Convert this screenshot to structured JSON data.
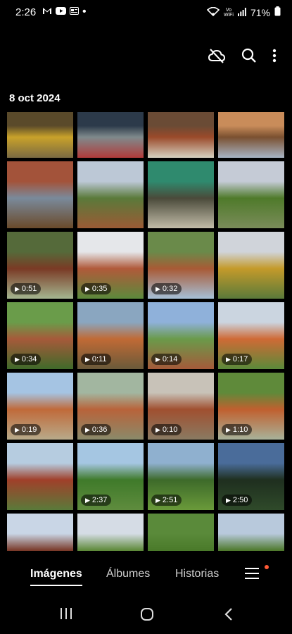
{
  "status_bar": {
    "time": "2:26",
    "battery": "71%",
    "wifi_label_1": "Vo",
    "wifi_label_2": "WiFi"
  },
  "gallery": {
    "date_header": "8 oct 2024",
    "tiles": [
      {
        "colors": [
          "#5a4a2a",
          "#c9a22a",
          "#7a6a42"
        ],
        "duration": ""
      },
      {
        "colors": [
          "#2c3a4a",
          "#7f8a8c",
          "#b23a3a"
        ],
        "duration": ""
      },
      {
        "colors": [
          "#6a4b35",
          "#9b4a2a",
          "#d5d0c0"
        ],
        "duration": ""
      },
      {
        "colors": [
          "#c98c5a",
          "#7a5030",
          "#a7b4c4"
        ],
        "duration": ""
      },
      {
        "colors": [
          "#a3533a",
          "#7a8a9b",
          "#6a4a2a"
        ],
        "duration": ""
      },
      {
        "colors": [
          "#bcc8d6",
          "#5a7a3a",
          "#9b5a35"
        ],
        "duration": ""
      },
      {
        "colors": [
          "#2f8a6e",
          "#4a4a3a",
          "#c2bca8"
        ],
        "duration": ""
      },
      {
        "colors": [
          "#c5cbd6",
          "#4f7a2a",
          "#7a8c5a"
        ],
        "duration": ""
      },
      {
        "colors": [
          "#556a3a",
          "#7a3a25",
          "#a4b690"
        ],
        "duration": "0:51"
      },
      {
        "colors": [
          "#e5e7ea",
          "#b05a3a",
          "#5c8a3c"
        ],
        "duration": "0:35"
      },
      {
        "colors": [
          "#6a8a4a",
          "#a85a35",
          "#a6c0d8"
        ],
        "duration": "0:32"
      },
      {
        "colors": [
          "#d0d4da",
          "#c49a2a",
          "#5a7a3a"
        ],
        "duration": ""
      },
      {
        "colors": [
          "#6a9c4a",
          "#a65a3a",
          "#3f6a2a"
        ],
        "duration": "0:34"
      },
      {
        "colors": [
          "#8aa6c0",
          "#c06a35",
          "#6a5a3a"
        ],
        "duration": "0:11"
      },
      {
        "colors": [
          "#8fb1da",
          "#6a9a4a",
          "#a55a3a"
        ],
        "duration": "0:14"
      },
      {
        "colors": [
          "#cbd5e0",
          "#cf6a35",
          "#5a8a3a"
        ],
        "duration": "0:17"
      },
      {
        "colors": [
          "#a5c4e3",
          "#c06a3a",
          "#b8aa8a"
        ],
        "duration": "0:19"
      },
      {
        "colors": [
          "#a2b6a0",
          "#b8633a",
          "#8a8a6a"
        ],
        "duration": "0:36"
      },
      {
        "colors": [
          "#c8c2b8",
          "#a05030",
          "#8a7a62"
        ],
        "duration": "0:10"
      },
      {
        "colors": [
          "#5f8a3a",
          "#c0602f",
          "#a8b29a"
        ],
        "duration": "1:10"
      },
      {
        "colors": [
          "#b6cce0",
          "#a0402a",
          "#5a7a3a"
        ],
        "duration": ""
      },
      {
        "colors": [
          "#a5c6e2",
          "#3f7a2a",
          "#5f8c3e"
        ],
        "duration": "2:37"
      },
      {
        "colors": [
          "#8fb0cf",
          "#3d6a2a",
          "#6a9a3a"
        ],
        "duration": "2:51"
      },
      {
        "colors": [
          "#4a6c9a",
          "#1f2f1f",
          "#2f4a2a"
        ],
        "duration": "2:50"
      },
      {
        "colors": [
          "#c9d6e6",
          "#7a3a2a",
          "#4a6a2a"
        ],
        "duration": ""
      },
      {
        "colors": [
          "#d5dce5",
          "#5e8a3a",
          "#7aa04a"
        ],
        "duration": ""
      },
      {
        "colors": [
          "#5a8a3a",
          "#4a7a2a",
          "#6a9a4a"
        ],
        "duration": ""
      },
      {
        "colors": [
          "#b8c9dc",
          "#4f7a2e",
          "#c0602f"
        ],
        "duration": ""
      }
    ]
  },
  "bottom_nav": {
    "tabs": [
      "Imágenes",
      "Álbumes",
      "Historias"
    ]
  }
}
